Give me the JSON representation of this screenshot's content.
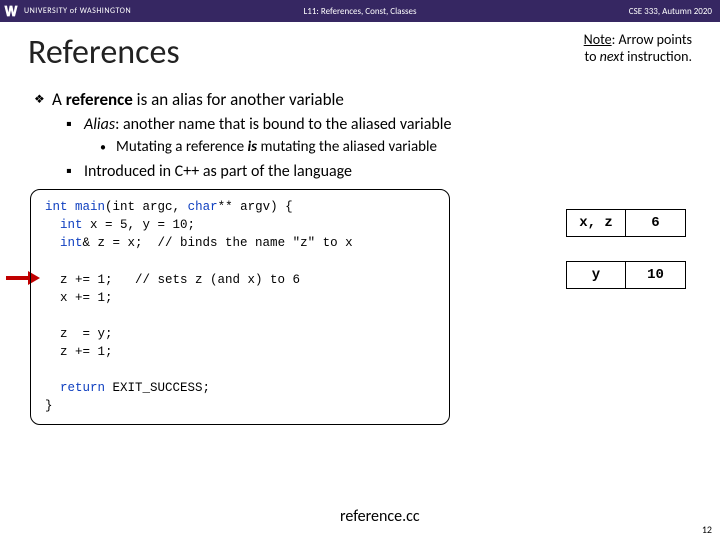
{
  "header": {
    "university": "UNIVERSITY of WASHINGTON",
    "lecture": "L11: References, Const, Classes",
    "course": "CSE 333, Autumn 2020"
  },
  "title": "References",
  "note_line1_prefix": "Note",
  "note_line1_rest": ": Arrow points",
  "note_line2_prefix": "to ",
  "note_line2_em": "next",
  "note_line2_rest": " instruction.",
  "bullets": {
    "l1_a_pre": "A ",
    "l1_a_bold": "reference",
    "l1_a_post": " is an alias for another variable",
    "l2_a_em": "Alias",
    "l2_a_post": ": another name that is bound to the aliased variable",
    "l3_a_pre": "Mutating a reference ",
    "l3_a_em": "is",
    "l3_a_post": " mutating the aliased variable",
    "l2_b": "Introduced in C++ as part of the language"
  },
  "code": {
    "l1a": "int",
    "l1b": " ",
    "l1c": "main",
    "l1d": "(int argc, ",
    "l1e": "char",
    "l1f": "** argv) {",
    "l2a": "  ",
    "l2b": "int",
    "l2c": " x = 5, y = 10;",
    "l3a": "  ",
    "l3b": "int",
    "l3c": "& z = x;  // binds the name \"z\" to x",
    "l4": " ",
    "l5": "  z += 1;   // sets z (and x) to 6",
    "l6": "  x += 1;",
    "l7": " ",
    "l8": "  z  = y;",
    "l9": "  z += 1;",
    "l10": " ",
    "l11a": "  ",
    "l11b": "return",
    "l11c": " EXIT_SUCCESS;",
    "l12": "}"
  },
  "memory": {
    "r1c1": "x, z",
    "r1c2": "6",
    "r2c1": "y",
    "r2c2": "10"
  },
  "filename": "reference.cc",
  "pagenum": "12"
}
